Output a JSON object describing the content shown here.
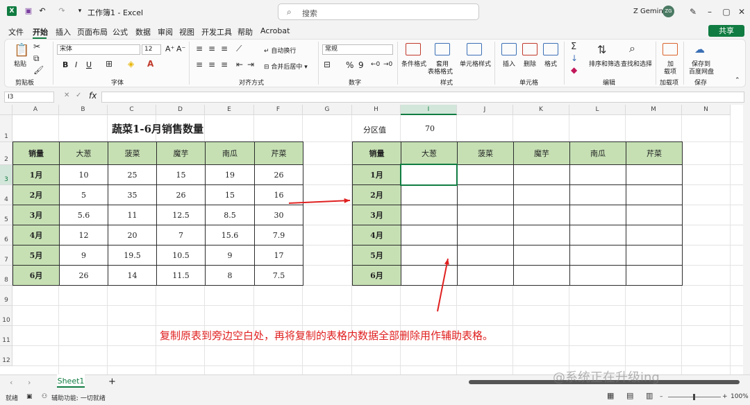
{
  "window": {
    "doc_title": "工作簿1 - Excel",
    "search_placeholder": "搜索",
    "user_name": "Z Gemini",
    "avatar_initials": "ZG",
    "share_label": "共享",
    "app_icon": "excel-icon"
  },
  "menu": [
    "文件",
    "开始",
    "插入",
    "页面布局",
    "公式",
    "数据",
    "审阅",
    "视图",
    "开发工具",
    "帮助",
    "Acrobat"
  ],
  "menu_active": "开始",
  "ribbon": {
    "paste": "粘贴",
    "clipboard": "剪贴板",
    "font_name": "宋体",
    "font_size": "12",
    "bold": "B",
    "italic": "I",
    "underline": "U",
    "font_group": "字体",
    "wrap": "自动换行",
    "merge": "合并后居中",
    "align_group": "对齐方式",
    "number_format": "常规",
    "percent": "%",
    "comma": "9",
    "number_group": "数字",
    "cond_format": "条件格式",
    "table_format_1": "套用",
    "table_format_2": "表格格式",
    "cell_style": "单元格样式",
    "style_group": "样式",
    "insert": "插入",
    "delete": "删除",
    "format": "格式",
    "cells_group": "单元格",
    "sort_filter": "排序和筛选",
    "find_select": "查找和选择",
    "edit_group": "编辑",
    "addin_1": "加",
    "addin_2": "载项",
    "addin_group": "加载项",
    "save_1": "保存到",
    "save_2": "百度网盘",
    "save_group": "保存"
  },
  "formula_bar": {
    "name_box": "I3",
    "fx": "fx",
    "formula": ""
  },
  "columns": [
    "A",
    "B",
    "C",
    "D",
    "E",
    "F",
    "G",
    "H",
    "I",
    "J",
    "K",
    "L",
    "M",
    "N"
  ],
  "selected_column": "I",
  "rows": [
    "1",
    "2",
    "3",
    "4",
    "5",
    "6",
    "7",
    "8",
    "9",
    "10",
    "11",
    "12"
  ],
  "selected_row": "3",
  "left_table": {
    "title": "蔬菜1-6月销售数量",
    "header": [
      "销量",
      "大葱",
      "菠菜",
      "魔芋",
      "南瓜",
      "芹菜"
    ],
    "months": [
      "1月",
      "2月",
      "3月",
      "4月",
      "5月",
      "6月"
    ],
    "values": [
      [
        "10",
        "25",
        "15",
        "19",
        "26"
      ],
      [
        "5",
        "35",
        "26",
        "15",
        "16"
      ],
      [
        "5.6",
        "11",
        "12.5",
        "8.5",
        "30"
      ],
      [
        "12",
        "20",
        "7",
        "15.6",
        "7.9"
      ],
      [
        "9",
        "19.5",
        "10.5",
        "9",
        "17"
      ],
      [
        "26",
        "14",
        "11.5",
        "8",
        "7.5"
      ]
    ]
  },
  "partition": {
    "label": "分区值",
    "value": "70"
  },
  "right_table": {
    "header": [
      "销量",
      "大葱",
      "菠菜",
      "魔芋",
      "南瓜",
      "芹菜"
    ],
    "months": [
      "1月",
      "2月",
      "3月",
      "4月",
      "5月",
      "6月"
    ]
  },
  "annotation": "复制原表到旁边空白处，再将复制的表格内数据全部删除用作辅助表格。",
  "sheet_tab": "Sheet1",
  "add_sheet": "+",
  "status": {
    "ready": "就绪",
    "accessibility": "辅助功能: 一切就绪",
    "zoom": "100%"
  },
  "watermark": "@系统正在升级ing",
  "colors": {
    "accent": "#107c41",
    "header_fill": "#c6e0b4",
    "annotation": "#e02020"
  }
}
